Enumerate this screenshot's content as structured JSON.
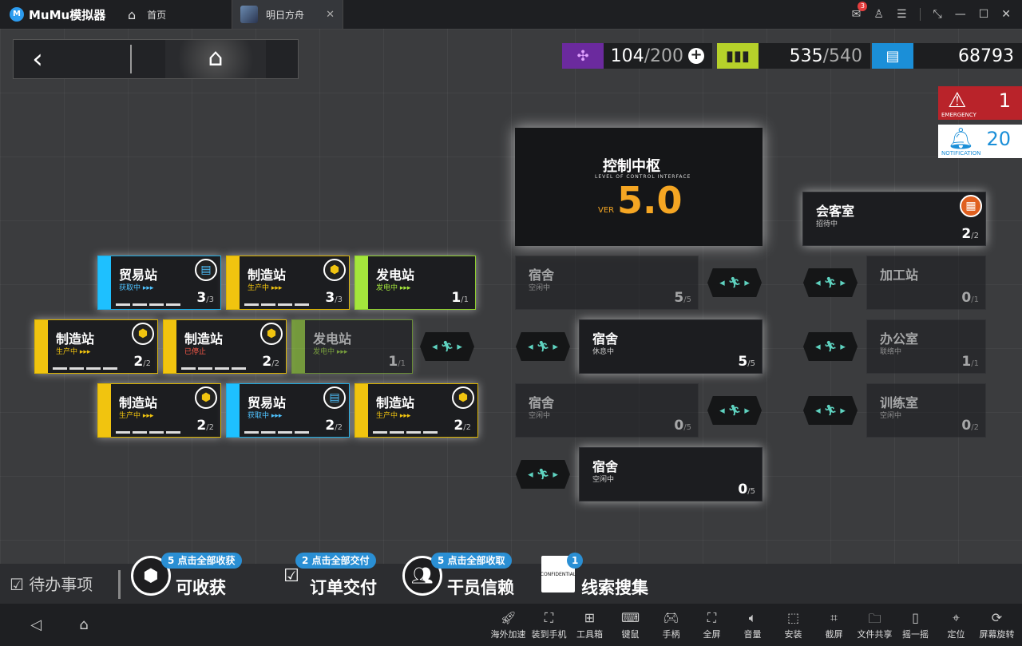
{
  "titlebar": {
    "app_name": "MuMu模拟器",
    "tabs": [
      {
        "label": "首页",
        "icon": "home-icon"
      },
      {
        "label": "明日方舟",
        "icon": "game-thumbnail"
      }
    ],
    "mail_badge": "3"
  },
  "hud": {
    "drones": {
      "current": "104",
      "max": "/200"
    },
    "power": {
      "current": "535",
      "max": "/540"
    },
    "lmd": "68793",
    "emergency": {
      "label": "EMERGENCY",
      "count": "1"
    },
    "notification": {
      "label": "NOTIFICATION",
      "count": "20"
    }
  },
  "control_center": {
    "title": "控制中枢",
    "subtitle": "LEVEL OF CONTROL INTERFACE",
    "version_label": "VER",
    "version": "5.0"
  },
  "rooms": [
    {
      "id": "trade1",
      "name": "贸易站",
      "status": "获取中 ▸▸▸",
      "count": "3",
      "max": "/3",
      "badge": "▤"
    },
    {
      "id": "mfg1",
      "name": "制造站",
      "status": "生产中 ▸▸▸",
      "count": "3",
      "max": "/3",
      "badge": "⬢"
    },
    {
      "id": "power1",
      "name": "发电站",
      "status": "发电中 ▸▸▸",
      "count": "1",
      "max": "/1"
    },
    {
      "id": "mfg2",
      "name": "制造站",
      "status": "生产中 ▸▸▸",
      "count": "2",
      "max": "/2",
      "badge": "⬢"
    },
    {
      "id": "mfg3",
      "name": "制造站",
      "status": "已停止",
      "count": "2",
      "max": "/2",
      "badge": "⬢"
    },
    {
      "id": "power2",
      "name": "发电站",
      "status": "发电中 ▸▸▸",
      "count": "1",
      "max": "/1"
    },
    {
      "id": "mfg4",
      "name": "制造站",
      "status": "生产中 ▸▸▸",
      "count": "2",
      "max": "/2",
      "badge": "⬢"
    },
    {
      "id": "trade2",
      "name": "贸易站",
      "status": "获取中 ▸▸▸",
      "count": "2",
      "max": "/2",
      "badge": "▤"
    },
    {
      "id": "mfg5",
      "name": "制造站",
      "status": "生产中 ▸▸▸",
      "count": "2",
      "max": "/2",
      "badge": "⬢"
    },
    {
      "id": "reception",
      "name": "会客室",
      "status": "招待中",
      "count": "2",
      "max": "/2",
      "badge": "▦"
    },
    {
      "id": "dorm1",
      "name": "宿舍",
      "status": "空闲中",
      "count": "5",
      "max": "/5"
    },
    {
      "id": "dorm2",
      "name": "宿舍",
      "status": "休息中",
      "count": "5",
      "max": "/5"
    },
    {
      "id": "dorm3",
      "name": "宿舍",
      "status": "空闲中",
      "count": "0",
      "max": "/5"
    },
    {
      "id": "dorm4",
      "name": "宿舍",
      "status": "空闲中",
      "count": "0",
      "max": "/5"
    },
    {
      "id": "workshop",
      "name": "加工站",
      "status": "",
      "count": "0",
      "max": "/1"
    },
    {
      "id": "office",
      "name": "办公室",
      "status": "联络中",
      "count": "1",
      "max": "/1"
    },
    {
      "id": "training",
      "name": "训练室",
      "status": "空闲中",
      "count": "0",
      "max": "/2"
    }
  ],
  "todo": {
    "title": "待办事项",
    "items": [
      {
        "pill": "5 点击全部收获",
        "label": "可收获"
      },
      {
        "pill": "2 点击全部交付",
        "label": "订单交付"
      },
      {
        "pill": "5 点击全部收取",
        "label": "干员信赖"
      },
      {
        "pill": "1",
        "label": "线索搜集",
        "icon_text": "CONFIDENTIAL"
      }
    ]
  },
  "toolbar": {
    "items": [
      {
        "label": "海外加速",
        "icon": "rocket-icon"
      },
      {
        "label": "装到手机",
        "icon": "phone-install-icon"
      },
      {
        "label": "工具箱",
        "icon": "toolbox-icon"
      },
      {
        "label": "键鼠",
        "icon": "keyboard-icon"
      },
      {
        "label": "手柄",
        "icon": "gamepad-icon"
      },
      {
        "label": "全屏",
        "icon": "fullscreen-icon"
      },
      {
        "label": "音量",
        "icon": "volume-icon"
      },
      {
        "label": "安装",
        "icon": "apk-install-icon"
      },
      {
        "label": "截屏",
        "icon": "screenshot-icon"
      },
      {
        "label": "文件共享",
        "icon": "folder-icon"
      },
      {
        "label": "摇一摇",
        "icon": "shake-icon"
      },
      {
        "label": "定位",
        "icon": "location-icon"
      },
      {
        "label": "屏幕旋转",
        "icon": "rotate-icon"
      }
    ]
  }
}
